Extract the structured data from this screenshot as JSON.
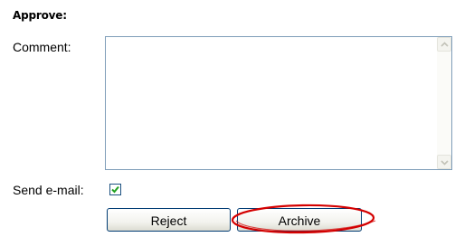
{
  "form": {
    "heading": "Approve:",
    "comment_label": "Comment:",
    "comment_value": "",
    "send_email_label": "Send e-mail:",
    "send_email_checked": true
  },
  "buttons": {
    "reject_label": "Reject",
    "archive_label": "Archive"
  },
  "annotation": {
    "highlight_color": "#d40000",
    "highlighted_element": "archive-button"
  },
  "icons": {
    "scroll_up": "scroll-up-arrow-icon",
    "scroll_down": "scroll-down-arrow-icon",
    "check": "checkmark-icon"
  },
  "colors": {
    "checkmark": "#21a121",
    "input_border": "#7f9db9",
    "button_border": "#003c74"
  }
}
